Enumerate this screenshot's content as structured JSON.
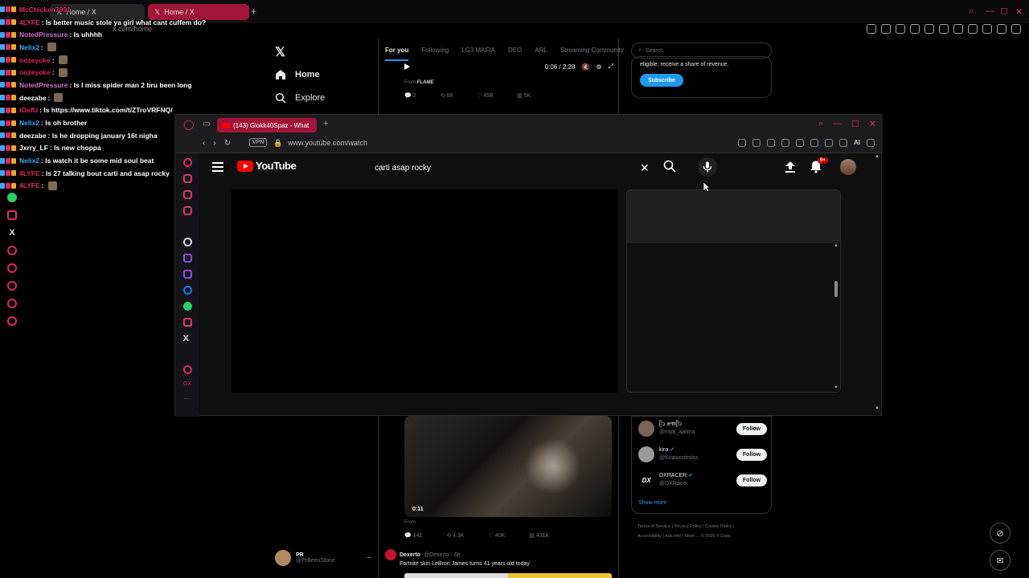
{
  "back_browser": {
    "tabs": [
      {
        "label": "Home / X"
      },
      {
        "label": "Home / X"
      }
    ],
    "address": "x.com/home",
    "vpn_label": "VPN"
  },
  "chat": [
    {
      "name": "McChicken7991",
      "color": "#e0245e",
      "msg": ""
    },
    {
      "name": "4LYFE",
      "color": "#e0245e",
      "msg": ": Is better music stole ya girl what cant cuffem do?"
    },
    {
      "name": "NotedPressure",
      "color": "#d86ad8",
      "msg": ": Is uhhhh"
    },
    {
      "name": "Nelix2",
      "color": "#3da9fc",
      "msg": ":"
    },
    {
      "name": "oozeyoke",
      "color": "#e0245e",
      "msg": ":"
    },
    {
      "name": "oozeyoke",
      "color": "#e0245e",
      "msg": ":"
    },
    {
      "name": "NotedPressure",
      "color": "#d86ad8",
      "msg": ": Is I miss spider man 2 bru been long"
    },
    {
      "name": "deezabe",
      "color": "#ffffff",
      "msg": ":"
    },
    {
      "name": "lOofU",
      "color": "#e0245e",
      "msg": ": Is https://www.tiktok.com/t/ZTroVRFNQ/"
    },
    {
      "name": "Nelix2",
      "color": "#3da9fc",
      "msg": ": Is oh brother"
    },
    {
      "name": "deezabe",
      "color": "#ffffff",
      "msg": ": Is he dropping january 16t nigha"
    },
    {
      "name": "Jxrry_LF",
      "color": "#ffffff",
      "msg": ": Is new choppa"
    },
    {
      "name": "Nelix2",
      "color": "#3da9fc",
      "msg": ": Is watch it be some mid soul beat"
    },
    {
      "name": "4LYFE",
      "color": "#e0245e",
      "msg": ": Is 27 talking bout carti and asap rocky"
    },
    {
      "name": "4LYFE",
      "color": "#e0245e",
      "msg": ":"
    }
  ],
  "x_page": {
    "nav": {
      "home": "Home",
      "explore": "Explore"
    },
    "feed_tabs": [
      "For you",
      "Following",
      "LG3 MAFIA",
      "DEO",
      "ARL",
      "Streaming Community"
    ],
    "video1": {
      "time": "0:06 / 2:28",
      "from_label": "From",
      "from_source": "FLAME"
    },
    "post1_actions": {
      "replies": "2",
      "reposts": "68",
      "likes": "458",
      "views": "5K"
    },
    "search_placeholder": "Search",
    "premium_text": "eligible, receive a share of revenue.",
    "subscribe_label": "Subscribe",
    "video2": {
      "time": "0:11",
      "from_label": "From"
    },
    "post2_actions": {
      "replies": "141",
      "reposts": "4.3K",
      "likes": "40K",
      "views": "431K"
    },
    "who_to_follow": [
      {
        "name": "ᥫᩣ ꪮ꧑ᥫᩣ",
        "handle": "@mya_aaliina",
        "button": "Follow"
      },
      {
        "name": "kira",
        "handle": "@Kirawontmiss",
        "button": "Follow"
      },
      {
        "name": "DXRACER",
        "handle": "@DXRacer",
        "button": "Follow"
      }
    ],
    "show_more": "Show more",
    "footer": [
      "Terms of Service",
      "Privacy Policy",
      "Cookie Policy",
      "Accessibility",
      "Ads info",
      "More ...",
      "© 2025 X Corp."
    ],
    "dexerto": {
      "name": "Dexerto",
      "handle": "@Dexerto · 6h",
      "text": "Fortnite skin LeBron James turns 41 years old today"
    },
    "pr_account": {
      "name": "PR",
      "handle": "@PrBeenStone"
    }
  },
  "front_browser": {
    "tab_label": "(143) Glokk40Spaz - What",
    "vpn_label": "VPN",
    "url": "www.youtube.com/watch",
    "ai_label": "AI"
  },
  "youtube": {
    "logo_text": "YouTube",
    "search_query": "carti asap rocky",
    "notification_count": "9+"
  },
  "colors": {
    "accent_opera": "#e0245e",
    "tab_active": "#a3153a",
    "x_blue": "#1d9bf0",
    "yt_red": "#ff0000"
  },
  "icons": {
    "x_logo": "x-logo-icon",
    "home": "home-icon",
    "explore": "search-icon",
    "yt_menu": "hamburger-icon",
    "yt_mic": "mic-icon",
    "yt_upload": "upload-icon",
    "yt_bell": "bell-icon"
  }
}
